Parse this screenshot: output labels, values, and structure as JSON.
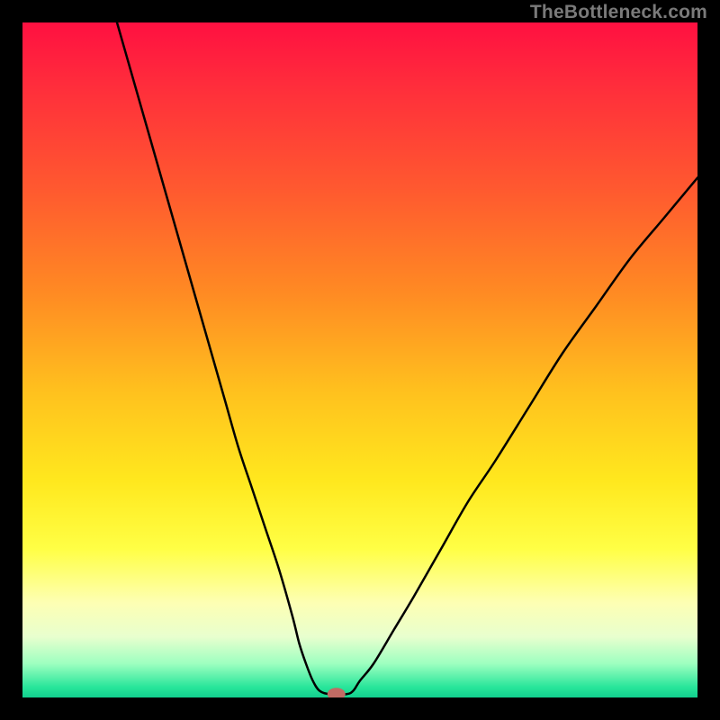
{
  "watermark": "TheBottleneck.com",
  "chart_data": {
    "type": "line",
    "title": "",
    "xlabel": "",
    "ylabel": "",
    "xlim": [
      0,
      100
    ],
    "ylim": [
      0,
      100
    ],
    "grid": false,
    "background_gradient": {
      "stops": [
        {
          "offset": 0.0,
          "color": "#ff1041"
        },
        {
          "offset": 0.1,
          "color": "#ff2f3b"
        },
        {
          "offset": 0.25,
          "color": "#ff5a2f"
        },
        {
          "offset": 0.4,
          "color": "#ff8a23"
        },
        {
          "offset": 0.55,
          "color": "#ffc21e"
        },
        {
          "offset": 0.68,
          "color": "#ffe81e"
        },
        {
          "offset": 0.78,
          "color": "#ffff45"
        },
        {
          "offset": 0.86,
          "color": "#fdffb4"
        },
        {
          "offset": 0.91,
          "color": "#e8ffce"
        },
        {
          "offset": 0.95,
          "color": "#9dffc0"
        },
        {
          "offset": 0.985,
          "color": "#27e59a"
        },
        {
          "offset": 1.0,
          "color": "#12cf8f"
        }
      ]
    },
    "series": [
      {
        "name": "bottleneck-curve",
        "color": "#000000",
        "x": [
          14,
          16,
          18,
          20,
          22,
          24,
          26,
          28,
          30,
          32,
          34,
          36,
          38,
          40,
          41,
          42,
          43,
          44,
          45.5,
          48,
          49,
          50,
          52,
          55,
          58,
          62,
          66,
          70,
          75,
          80,
          85,
          90,
          95,
          100
        ],
        "y": [
          100,
          93,
          86,
          79,
          72,
          65,
          58,
          51,
          44,
          37,
          31,
          25,
          19,
          12,
          8,
          5,
          2.5,
          1,
          0.5,
          0.5,
          1,
          2.5,
          5,
          10,
          15,
          22,
          29,
          35,
          43,
          51,
          58,
          65,
          71,
          77
        ]
      }
    ],
    "marker": {
      "name": "optimum-point",
      "x": 46.5,
      "y": 0.5,
      "color": "#c26b64",
      "rx": 10,
      "ry": 7
    }
  }
}
